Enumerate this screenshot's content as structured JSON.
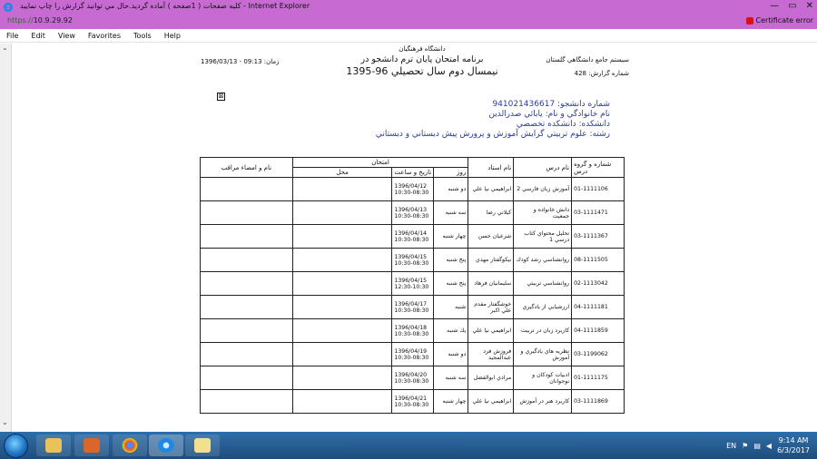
{
  "window": {
    "title": "كليه صفحات ( 1صفحه ) آماده گرديد.حال مي توانيد گزارش را چاپ نماييد - Internet Explorer",
    "url_scheme": "https://",
    "url_host": "10.9.29.92",
    "certificate": "Certificate error",
    "minimize": "—",
    "maximize": "▭",
    "close": "✕"
  },
  "menu": [
    "File",
    "Edit",
    "View",
    "Favorites",
    "Tools",
    "Help"
  ],
  "report": {
    "system_name": "سيستم جامع دانشگاهي گلستان",
    "report_number_label": "شماره گزارش:",
    "report_number": "428",
    "university": "دانشگاه فرهنگيان",
    "program_title": "برنامه امتحان پايان ترم دانشجو در",
    "semester": "نيمسال دوم سال تحصيلي 96-1395",
    "time_label": "زمان:",
    "time_value": "09:13 - 1396/03/13",
    "box_mark": "⊠"
  },
  "student": {
    "id_label": "شماره دانشجو:",
    "id_value": "941021436617",
    "name_label": "نام خانوادگي و نام:",
    "name_value": "يابائي صدرالدين",
    "faculty_label": "دانشكده:",
    "faculty_value": "دانشكده تخصصي",
    "major_label": "رشته:",
    "major_value": "علوم تربيتي گرايش آموزش و پرورش پيش دبستاني و دبستاني"
  },
  "table": {
    "headers": {
      "code": "شماره و گروه درس",
      "course": "نام درس",
      "teacher": "نام استاد",
      "exam": "امتحان",
      "day": "روز",
      "datetime": "تاريخ و ساعت",
      "place": "محل",
      "sign": "نام و امضاء مراقب"
    },
    "rows": [
      {
        "code": "01-1111106",
        "course": "آموزش زبان فارسي 2",
        "teacher": "ابراهيمي نيا علي",
        "day": "دو شنبه",
        "date": "1396/04/12",
        "time": "10:30-08:30"
      },
      {
        "code": "03-1111471",
        "course": "دانش خانواده و جمعيت",
        "teacher": "كيلاني رضا",
        "day": "سه شنبه",
        "date": "1396/04/13",
        "time": "10:30-08:30"
      },
      {
        "code": "03-1111367",
        "course": "تحليل محتواي كتاب درسي 1",
        "teacher": "شرعيان حسن",
        "day": "چهار شنبه",
        "date": "1396/04/14",
        "time": "10:30-08:30"
      },
      {
        "code": "08-1111505",
        "course": "روانشناسي رشد كودك",
        "teacher": "نيكوگفتار مهدي",
        "day": "پنج شنبه",
        "date": "1396/04/15",
        "time": "10:30-08:30"
      },
      {
        "code": "02-1113042",
        "course": "روانشناسي تربيتي",
        "teacher": "سليمانيان فرهاد",
        "day": "پنج شنبه",
        "date": "1396/04/15",
        "time": "12:30-10:30"
      },
      {
        "code": "04-1111181",
        "course": "ارزشيابي از يادگيري",
        "teacher": "خوشگفتار مقدم علي اكبر",
        "day": "شنبه",
        "date": "1396/04/17",
        "time": "10:30-08:30"
      },
      {
        "code": "04-1111859",
        "course": "كاربرد زبان در تربيت",
        "teacher": "ابراهيمي نيا علي",
        "day": "يك شنبه",
        "date": "1396/04/18",
        "time": "10:30-08:30"
      },
      {
        "code": "03-1199062",
        "course": "نظريه هاي يادگيري و آموزش",
        "teacher": "فروزش فرد عبدالمجيد",
        "day": "دو شنبه",
        "date": "1396/04/19",
        "time": "10:30-08:30"
      },
      {
        "code": "01-1111175",
        "course": "ادبيات كودكان و نوجوانان",
        "teacher": "مرادي ابوالفضل",
        "day": "سه شنبه",
        "date": "1396/04/20",
        "time": "10:30-08:30"
      },
      {
        "code": "03-1111869",
        "course": "كاربرد هنر در آموزش",
        "teacher": "ابراهيمي نيا علي",
        "day": "چهار شنبه",
        "date": "1396/04/21",
        "time": "10:30-08:30"
      }
    ]
  },
  "taskbar": {
    "lang": "EN",
    "time": "9:14 AM",
    "date": "6/3/2017"
  },
  "colors": {
    "chrome": "#c76bd3",
    "student_text": "#2b3b9a",
    "taskbar": "#2f6ea8"
  }
}
